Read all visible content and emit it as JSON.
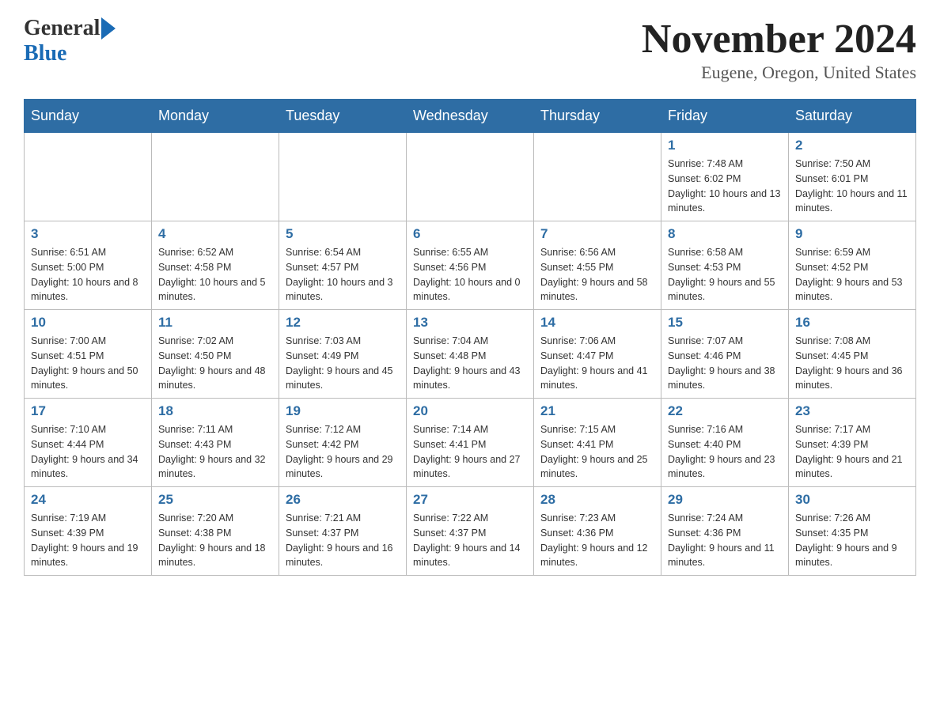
{
  "header": {
    "logo_general": "General",
    "logo_blue": "Blue",
    "title": "November 2024",
    "location": "Eugene, Oregon, United States"
  },
  "days_of_week": [
    "Sunday",
    "Monday",
    "Tuesday",
    "Wednesday",
    "Thursday",
    "Friday",
    "Saturday"
  ],
  "weeks": [
    [
      {
        "day": "",
        "info": ""
      },
      {
        "day": "",
        "info": ""
      },
      {
        "day": "",
        "info": ""
      },
      {
        "day": "",
        "info": ""
      },
      {
        "day": "",
        "info": ""
      },
      {
        "day": "1",
        "info": "Sunrise: 7:48 AM\nSunset: 6:02 PM\nDaylight: 10 hours and 13 minutes."
      },
      {
        "day": "2",
        "info": "Sunrise: 7:50 AM\nSunset: 6:01 PM\nDaylight: 10 hours and 11 minutes."
      }
    ],
    [
      {
        "day": "3",
        "info": "Sunrise: 6:51 AM\nSunset: 5:00 PM\nDaylight: 10 hours and 8 minutes."
      },
      {
        "day": "4",
        "info": "Sunrise: 6:52 AM\nSunset: 4:58 PM\nDaylight: 10 hours and 5 minutes."
      },
      {
        "day": "5",
        "info": "Sunrise: 6:54 AM\nSunset: 4:57 PM\nDaylight: 10 hours and 3 minutes."
      },
      {
        "day": "6",
        "info": "Sunrise: 6:55 AM\nSunset: 4:56 PM\nDaylight: 10 hours and 0 minutes."
      },
      {
        "day": "7",
        "info": "Sunrise: 6:56 AM\nSunset: 4:55 PM\nDaylight: 9 hours and 58 minutes."
      },
      {
        "day": "8",
        "info": "Sunrise: 6:58 AM\nSunset: 4:53 PM\nDaylight: 9 hours and 55 minutes."
      },
      {
        "day": "9",
        "info": "Sunrise: 6:59 AM\nSunset: 4:52 PM\nDaylight: 9 hours and 53 minutes."
      }
    ],
    [
      {
        "day": "10",
        "info": "Sunrise: 7:00 AM\nSunset: 4:51 PM\nDaylight: 9 hours and 50 minutes."
      },
      {
        "day": "11",
        "info": "Sunrise: 7:02 AM\nSunset: 4:50 PM\nDaylight: 9 hours and 48 minutes."
      },
      {
        "day": "12",
        "info": "Sunrise: 7:03 AM\nSunset: 4:49 PM\nDaylight: 9 hours and 45 minutes."
      },
      {
        "day": "13",
        "info": "Sunrise: 7:04 AM\nSunset: 4:48 PM\nDaylight: 9 hours and 43 minutes."
      },
      {
        "day": "14",
        "info": "Sunrise: 7:06 AM\nSunset: 4:47 PM\nDaylight: 9 hours and 41 minutes."
      },
      {
        "day": "15",
        "info": "Sunrise: 7:07 AM\nSunset: 4:46 PM\nDaylight: 9 hours and 38 minutes."
      },
      {
        "day": "16",
        "info": "Sunrise: 7:08 AM\nSunset: 4:45 PM\nDaylight: 9 hours and 36 minutes."
      }
    ],
    [
      {
        "day": "17",
        "info": "Sunrise: 7:10 AM\nSunset: 4:44 PM\nDaylight: 9 hours and 34 minutes."
      },
      {
        "day": "18",
        "info": "Sunrise: 7:11 AM\nSunset: 4:43 PM\nDaylight: 9 hours and 32 minutes."
      },
      {
        "day": "19",
        "info": "Sunrise: 7:12 AM\nSunset: 4:42 PM\nDaylight: 9 hours and 29 minutes."
      },
      {
        "day": "20",
        "info": "Sunrise: 7:14 AM\nSunset: 4:41 PM\nDaylight: 9 hours and 27 minutes."
      },
      {
        "day": "21",
        "info": "Sunrise: 7:15 AM\nSunset: 4:41 PM\nDaylight: 9 hours and 25 minutes."
      },
      {
        "day": "22",
        "info": "Sunrise: 7:16 AM\nSunset: 4:40 PM\nDaylight: 9 hours and 23 minutes."
      },
      {
        "day": "23",
        "info": "Sunrise: 7:17 AM\nSunset: 4:39 PM\nDaylight: 9 hours and 21 minutes."
      }
    ],
    [
      {
        "day": "24",
        "info": "Sunrise: 7:19 AM\nSunset: 4:39 PM\nDaylight: 9 hours and 19 minutes."
      },
      {
        "day": "25",
        "info": "Sunrise: 7:20 AM\nSunset: 4:38 PM\nDaylight: 9 hours and 18 minutes."
      },
      {
        "day": "26",
        "info": "Sunrise: 7:21 AM\nSunset: 4:37 PM\nDaylight: 9 hours and 16 minutes."
      },
      {
        "day": "27",
        "info": "Sunrise: 7:22 AM\nSunset: 4:37 PM\nDaylight: 9 hours and 14 minutes."
      },
      {
        "day": "28",
        "info": "Sunrise: 7:23 AM\nSunset: 4:36 PM\nDaylight: 9 hours and 12 minutes."
      },
      {
        "day": "29",
        "info": "Sunrise: 7:24 AM\nSunset: 4:36 PM\nDaylight: 9 hours and 11 minutes."
      },
      {
        "day": "30",
        "info": "Sunrise: 7:26 AM\nSunset: 4:35 PM\nDaylight: 9 hours and 9 minutes."
      }
    ]
  ]
}
